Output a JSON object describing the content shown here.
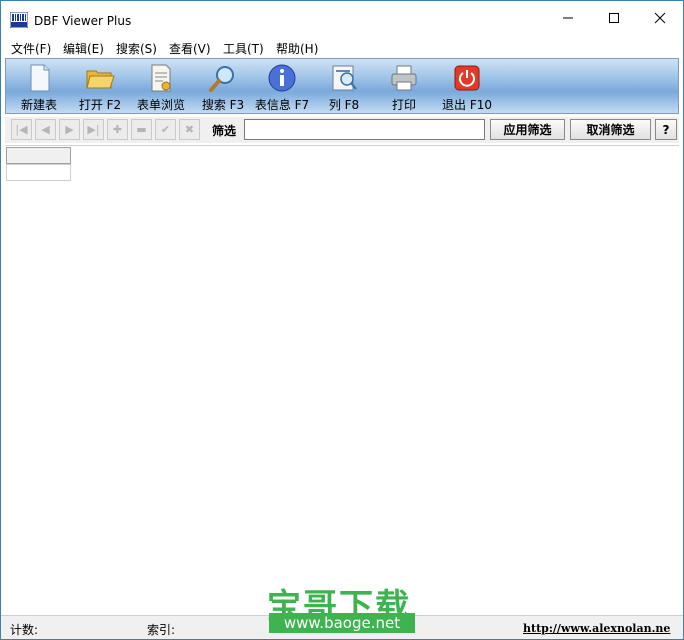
{
  "window": {
    "title": "DBF Viewer Plus"
  },
  "menu": [
    {
      "label": "文件(F)"
    },
    {
      "label": "编辑(E)"
    },
    {
      "label": "搜索(S)"
    },
    {
      "label": "查看(V)"
    },
    {
      "label": "工具(T)"
    },
    {
      "label": "帮助(H)"
    }
  ],
  "toolbar": [
    {
      "label": "新建表",
      "icon": "new-document-icon"
    },
    {
      "label": "打开 F2",
      "icon": "open-folder-icon"
    },
    {
      "label": "表单浏览",
      "icon": "form-view-icon"
    },
    {
      "label": "搜索 F3",
      "icon": "magnifier-icon"
    },
    {
      "label": "表信息 F7",
      "icon": "info-icon"
    },
    {
      "label": "列 F8",
      "icon": "columns-icon"
    },
    {
      "label": "打印",
      "icon": "printer-icon"
    },
    {
      "label": "退出 F10",
      "icon": "power-icon"
    }
  ],
  "filter": {
    "label": "筛选",
    "value": "",
    "apply_label": "应用筛选",
    "cancel_label": "取消筛选",
    "help_label": "?"
  },
  "status": {
    "count_label": "计数:",
    "index_label": "索引:",
    "url": "http://www.alexnolan.ne"
  },
  "watermark": {
    "title": "宝哥下载",
    "site": "www.baoge.net"
  }
}
